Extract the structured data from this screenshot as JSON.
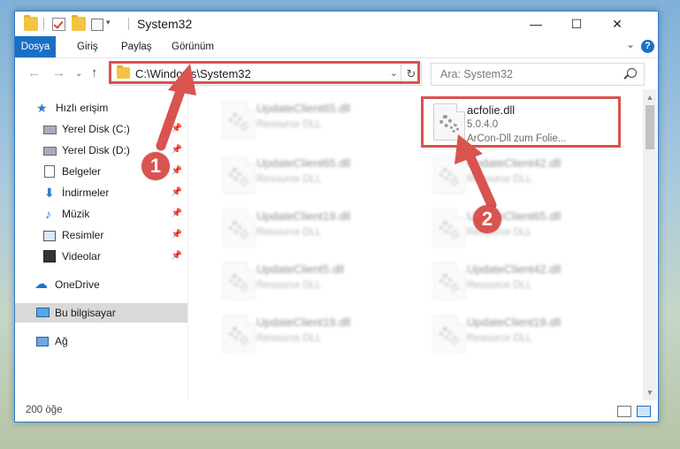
{
  "titlebar": {
    "title": "System32",
    "minimize": "—",
    "maximize": "☐",
    "close": "✕"
  },
  "ribbon": {
    "tabs": [
      "Dosya",
      "Giriş",
      "Paylaş",
      "Görünüm"
    ],
    "help": "?"
  },
  "address": {
    "path": "C:\\Windows\\System32",
    "search_placeholder": "Ara: System32"
  },
  "sidebar": {
    "items": [
      {
        "label": "Hızlı erişim"
      },
      {
        "label": "Yerel Disk (C:)"
      },
      {
        "label": "Yerel Disk (D:)"
      },
      {
        "label": "Belgeler"
      },
      {
        "label": "İndirmeler"
      },
      {
        "label": "Müzik"
      },
      {
        "label": "Resimler"
      },
      {
        "label": "Videolar"
      },
      {
        "label": "OneDrive"
      },
      {
        "label": "Bu bilgisayar"
      },
      {
        "label": "Ağ"
      }
    ]
  },
  "files": {
    "highlighted": {
      "name": "acfolie.dll",
      "version": "5.0.4.0",
      "description": "ArCon-Dll zum Folie..."
    },
    "left": [
      {
        "name": "UpdateClient65.dll",
        "type": "Resource DLL"
      },
      {
        "name": "UpdateClient65.dll",
        "type": "Resource DLL"
      },
      {
        "name": "UpdateClient19.dll",
        "type": "Resource DLL"
      },
      {
        "name": "UpdateClient5.dll",
        "type": "Resource DLL"
      },
      {
        "name": "UpdateClient19.dll",
        "type": "Resource DLL"
      }
    ],
    "right": [
      {
        "name": "UpdateClient42.dll",
        "type": "Resource DLL"
      },
      {
        "name": "UpdateClient65.dll",
        "type": "Resource DLL"
      },
      {
        "name": "UpdateClient42.dll",
        "type": "Resource DLL"
      },
      {
        "name": "UpdateClient19.dll",
        "type": "Resource DLL"
      }
    ]
  },
  "status": {
    "count": "200 öğe"
  },
  "annotations": {
    "step1": "1",
    "step2": "2",
    "color": "#d9534f"
  }
}
